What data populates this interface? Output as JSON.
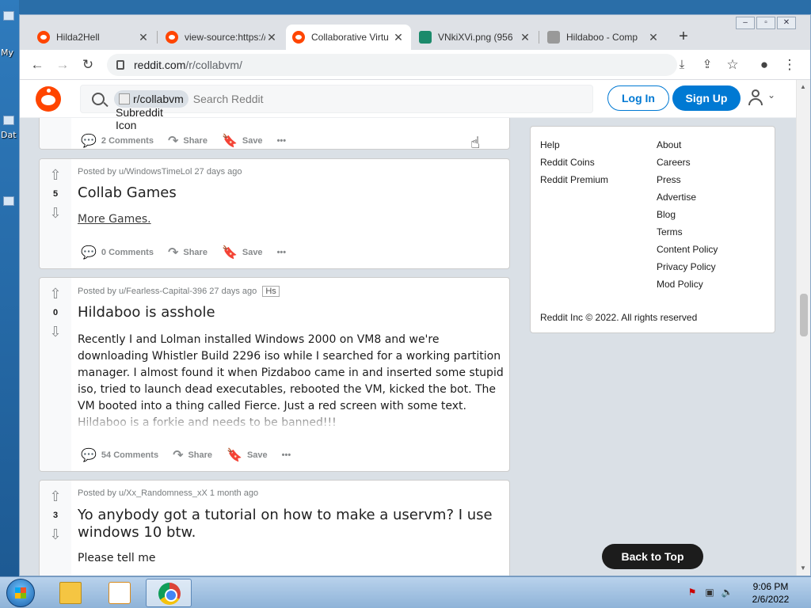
{
  "desktop": {
    "labels": [
      "My",
      "Dat"
    ]
  },
  "browser": {
    "tabs": [
      {
        "title": "Hilda2Hell",
        "favicon": "reddit-icon",
        "active": false
      },
      {
        "title": "view-source:https://",
        "favicon": "reddit-icon",
        "active": false
      },
      {
        "title": "Collaborative Virtu",
        "favicon": "reddit-icon",
        "active": true
      },
      {
        "title": "VNkiXVi.png (956",
        "favicon": "image-icon",
        "active": false
      },
      {
        "title": "Hildaboo - Comp",
        "favicon": "collabvm-icon",
        "active": false
      }
    ],
    "url_host": "reddit.com",
    "url_path": "/r/collabvm/"
  },
  "reddit_header": {
    "search_chip": "r/collabvm",
    "chip_alt_text": "Subreddit Icon",
    "search_placeholder": "Search Reddit",
    "login_label": "Log In",
    "signup_label": "Sign Up"
  },
  "posts": [
    {
      "comments_label": "2 Comments",
      "share_label": "Share",
      "save_label": "Save"
    },
    {
      "meta": "Posted by u/WindowsTimeLol 27 days ago",
      "votes": "5",
      "title": "Collab Games",
      "body": "More Games.",
      "comments_label": "0 Comments",
      "share_label": "Share",
      "save_label": "Save"
    },
    {
      "meta": "Posted by u/Fearless-Capital-396 27 days ago",
      "award_alt": "Hs",
      "votes": "0",
      "title": "Hildaboo is asshole",
      "body": "Recently I and Lolman installed Windows 2000 on VM8 and we're downloading Whistler Build 2296 iso while I searched for a working partition manager. I almost found it when Pizdaboo came in and inserted some stupid iso, tried to launch dead executables, rebooted the VM, kicked the bot. The VM booted into a thing called Fierce. Just a red screen with some text. Hildaboo is a forkie and needs to be banned!!!",
      "comments_label": "54 Comments",
      "share_label": "Share",
      "save_label": "Save"
    },
    {
      "meta": "Posted by u/Xx_Randomness_xX 1 month ago",
      "votes": "3",
      "title": "Yo anybody got a tutorial on how to make a uservm? I use windows 10 btw.",
      "body": "Please tell me"
    }
  ],
  "sidebar": {
    "col1": [
      "Help",
      "Reddit Coins",
      "Reddit Premium"
    ],
    "col2": [
      "About",
      "Careers",
      "Press",
      "Advertise",
      "Blog",
      "Terms",
      "Content Policy",
      "Privacy Policy",
      "Mod Policy"
    ],
    "copyright": "Reddit Inc © 2022. All rights reserved"
  },
  "back_to_top": "Back to Top",
  "taskbar": {
    "time": "9:06 PM",
    "date": "2/6/2022"
  }
}
